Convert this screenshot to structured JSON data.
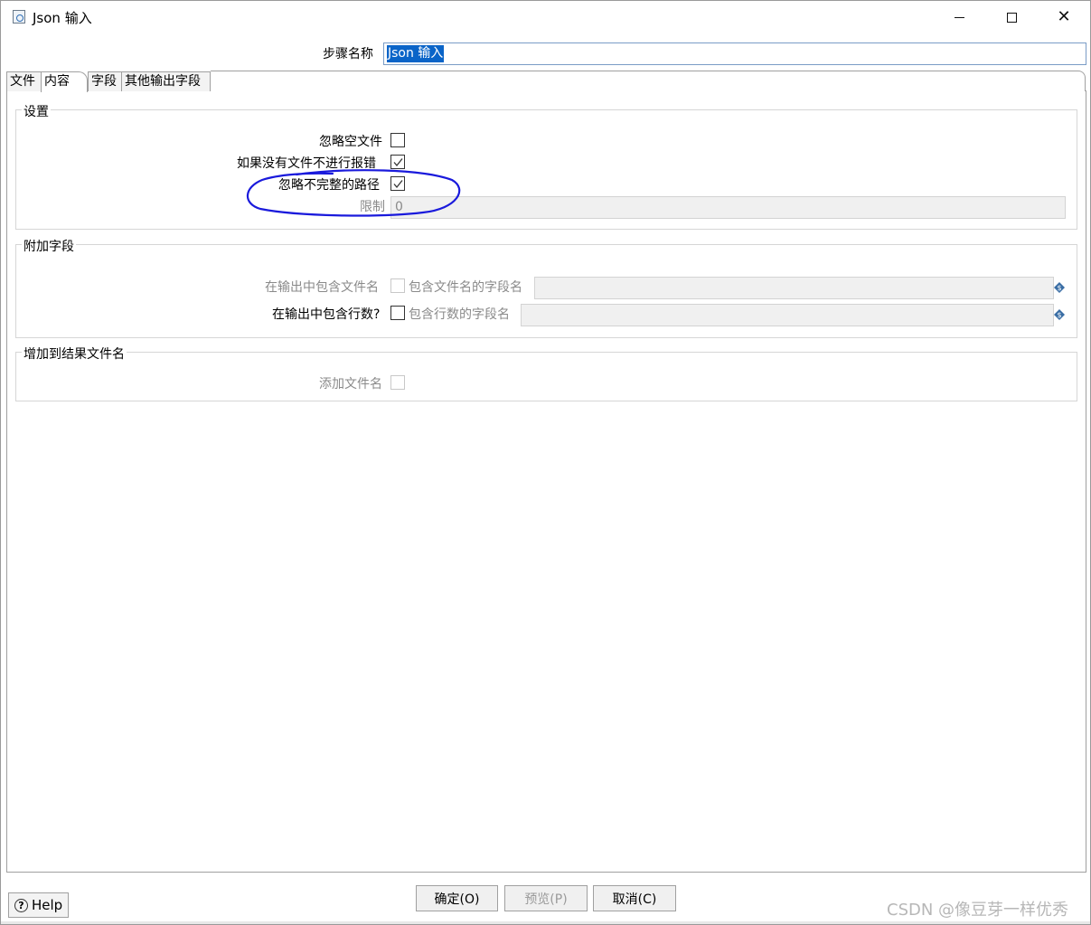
{
  "window": {
    "title": "Json 输入"
  },
  "step": {
    "label": "步骤名称",
    "value": "Json 输入"
  },
  "tabs": [
    {
      "label": "文件"
    },
    {
      "label": "内容"
    },
    {
      "label": "字段"
    },
    {
      "label": "其他输出字段"
    }
  ],
  "settings": {
    "title": "设置",
    "ignore_empty_file": {
      "label": "忽略空文件",
      "checked": false
    },
    "no_error_if_no_file": {
      "label": "如果没有文件不进行报错",
      "checked": true
    },
    "ignore_missing_path": {
      "label": "忽略不完整的路径",
      "checked": true
    },
    "limit": {
      "label": "限制",
      "value": "0"
    }
  },
  "extra_fields": {
    "title": "附加字段",
    "include_filename": {
      "label": "在输出中包含文件名",
      "field_label": "包含文件名的字段名",
      "checked": false
    },
    "include_rownum": {
      "label": "在输出中包含行数?",
      "field_label": "包含行数的字段名",
      "checked": false
    }
  },
  "result_files": {
    "title": "增加到结果文件名",
    "add_filename": {
      "label": "添加文件名",
      "checked": false
    }
  },
  "buttons": {
    "help": "Help",
    "ok": "确定(O)",
    "preview": "预览(P)",
    "cancel": "取消(C)"
  },
  "watermark": "CSDN @像豆芽一样优秀",
  "annotation": {
    "color": "#1a1adc"
  }
}
